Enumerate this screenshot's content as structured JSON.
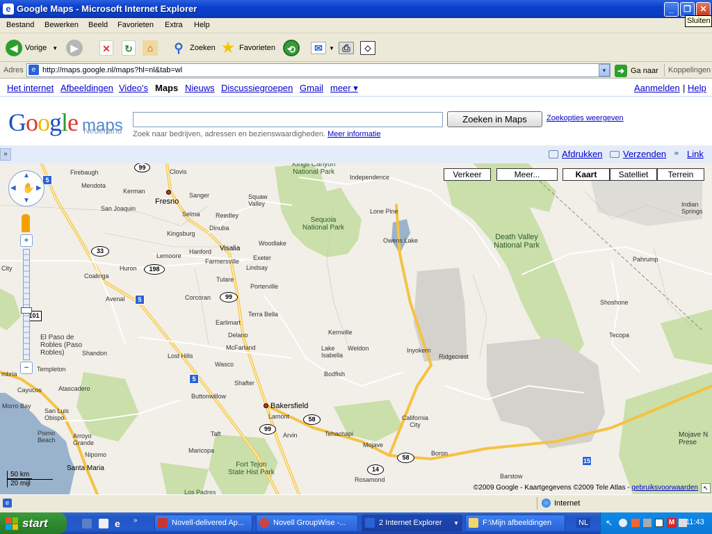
{
  "window": {
    "title": "Google Maps - Microsoft Internet Explorer",
    "tooltip": "Sluiten"
  },
  "menu": [
    "Bestand",
    "Bewerken",
    "Beeld",
    "Favorieten",
    "Extra",
    "Help"
  ],
  "toolbar": {
    "back": "Vorige",
    "search": "Zoeken",
    "favorites": "Favorieten"
  },
  "address": {
    "label": "Adres",
    "url": "http://maps.google.nl/maps?hl=nl&tab=wl",
    "go": "Ga naar",
    "links": "Koppelingen"
  },
  "gbar": {
    "items": [
      "Het internet",
      "Afbeeldingen",
      "Video's",
      "Maps",
      "Nieuws",
      "Discussiegroepen",
      "Gmail",
      "meer ▾"
    ],
    "signin": "Aanmelden",
    "help": "Help"
  },
  "logo": {
    "google": "Google",
    "maps": "maps",
    "region": "Nederland"
  },
  "search": {
    "button": "Zoeken in Maps",
    "options": "Zoekopties weergeven",
    "hint": "Zoek naar bedrijven, adressen en bezienswaardigheden.",
    "more": "Meer informatie"
  },
  "actions": {
    "print": "Afdrukken",
    "send": "Verzenden",
    "link": "Link"
  },
  "map": {
    "buttons": {
      "traffic": "Verkeer",
      "more": "Meer...",
      "map": "Kaart",
      "satellite": "Satelliet",
      "terrain": "Terrein"
    },
    "copyright": "©2009 Google - Kaartgegevens ©2009 Tele Atlas - ",
    "terms": "gebruiksvoorwaarden",
    "scale_km": "50 km",
    "scale_mi": "20 mijl",
    "labels": {
      "firebaugh": "Firebaugh",
      "mendota": "Mendota",
      "kerman": "Kerman",
      "fresno": "Fresno",
      "clovis": "Clovis",
      "sanger": "Sanger",
      "san_joaquin": "San Joaquin",
      "squaw_valley": "Squaw\nValley",
      "reedley": "Reedley",
      "selma": "Selma",
      "dinuba": "Dinuba",
      "kingsburg": "Kingsburg",
      "lemoore": "Lemoore",
      "hanford": "Hanford",
      "visalia": "Visalia",
      "woodlake": "Woodlake",
      "kings_canyon": "Kings Canyon\nNational Park",
      "sequoia": "Sequoia\nNational Park",
      "independence": "Independence",
      "lone_pine": "Lone Pine",
      "owens_lake": "Owens Lake",
      "death_valley": "Death Valley\nNational Park",
      "indian_springs": "Indian\nSprings",
      "pahrump": "Pahrump",
      "shoshone": "Shoshone",
      "tecopa": "Tecopa",
      "huron": "Huron",
      "farmersville": "Farmersville",
      "exeter": "Exeter",
      "lindsay": "Lindsay",
      "coalinga": "Coalinga",
      "avenal": "Avenal",
      "corcoran": "Corcoran",
      "tulare": "Tulare",
      "porterville": "Porterville",
      "terra_bella": "Terra Bella",
      "earlimart": "Earlimart",
      "delano": "Delano",
      "mcfarland": "McFarland",
      "kernville": "Kernville",
      "lake_isabella": "Lake\nIsabella",
      "weldon": "Weldon",
      "inyokern": "Inyokern",
      "ridgecrest": "Ridgecrest",
      "el_paso_de_robles": "El Paso de\nRobles (Paso\nRobles)",
      "shandon": "Shandon",
      "lost_hills": "Lost Hills",
      "wasco": "Wasco",
      "shafter": "Shafter",
      "bodfish": "Bodfish",
      "templeton": "Templeton",
      "atascadero": "Atascadero",
      "cayucos": "Cayucos",
      "buttonwillow": "Buttonwillow",
      "bakersfield": "Bakersfield",
      "lamont": "Lamont",
      "arvin": "Arvin",
      "morro_bay": "Morro Bay",
      "san_luis_obispo": "San Luis\nObispo",
      "pismo_beach": "Pismo\nBeach",
      "arroyo_grande": "Arroyo\nGrande",
      "nipomo": "Nipomo",
      "santa_maria": "Santa Maria",
      "taft": "Taft",
      "maricopa": "Maricopa",
      "fort_tejon": "Fort Tejon\nState Hist Park",
      "tehachapi": "Tehachapi",
      "mojave": "Mojave",
      "california_city": "California\nCity",
      "boron": "Boron",
      "rosamond": "Rosamond",
      "barstow": "Barstow",
      "mojave_preserve": "Mojave N\nPrese",
      "city": "City",
      "mbria": "mbria",
      "lompoc": "Los Padres"
    },
    "shields": {
      "s99a": "99",
      "s5a": "5",
      "s33": "33",
      "s198": "198",
      "s99b": "99",
      "s5b": "5",
      "s101": "101",
      "s5c": "5",
      "s99c": "99",
      "s58a": "58",
      "s58b": "58",
      "s14": "14",
      "s15": "15"
    }
  },
  "status": {
    "zone": "Internet"
  },
  "taskbar": {
    "start": "start",
    "tasks": [
      "Novell-delivered Ap...",
      "Novell GroupWise -...",
      "2 Internet Explorer",
      "F:\\Mijn afbeeldingen"
    ],
    "lang": "NL",
    "clock": "11:43"
  }
}
